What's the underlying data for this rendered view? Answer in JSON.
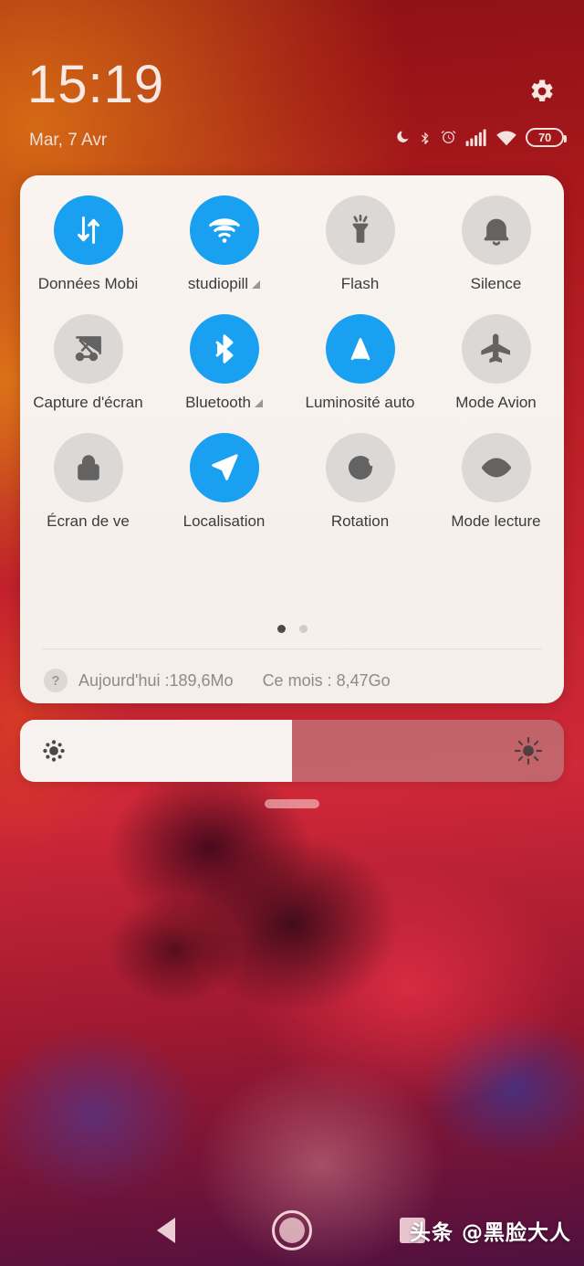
{
  "header": {
    "clock": "15:19",
    "date": "Mar, 7 Avr",
    "settings_icon": "gear-icon",
    "status_icons": [
      {
        "name": "do-not-disturb-moon-icon"
      },
      {
        "name": "bluetooth-icon"
      },
      {
        "name": "alarm-clock-icon"
      },
      {
        "name": "cellular-signal-icon"
      },
      {
        "name": "wifi-icon"
      }
    ],
    "battery_level": "70"
  },
  "quick_settings": {
    "tiles": [
      {
        "label": "Données Mobi",
        "icon": "mobile-data-arrows-icon",
        "active": true,
        "has_arrow": false
      },
      {
        "label": "studiopill",
        "icon": "wifi-icon",
        "active": true,
        "has_arrow": true
      },
      {
        "label": "Flash",
        "icon": "flashlight-icon",
        "active": false,
        "has_arrow": false
      },
      {
        "label": "Silence",
        "icon": "bell-icon",
        "active": false,
        "has_arrow": false
      },
      {
        "label": "Capture d'écran",
        "icon": "screenshot-scissors-icon",
        "active": false,
        "has_arrow": false
      },
      {
        "label": "Bluetooth",
        "icon": "bluetooth-icon",
        "active": true,
        "has_arrow": true
      },
      {
        "label": "Luminosité auto",
        "icon": "auto-brightness-a-icon",
        "active": true,
        "has_arrow": false
      },
      {
        "label": "Mode Avion",
        "icon": "airplane-icon",
        "active": false,
        "has_arrow": false
      },
      {
        "label": "Écran de ve",
        "icon": "lock-icon",
        "active": false,
        "has_arrow": false
      },
      {
        "label": "Localisation",
        "icon": "location-arrow-icon",
        "active": true,
        "has_arrow": false
      },
      {
        "label": "Rotation",
        "icon": "rotation-lock-icon",
        "active": false,
        "has_arrow": false
      },
      {
        "label": "Mode lecture",
        "icon": "eye-icon",
        "active": false,
        "has_arrow": false
      }
    ],
    "pages": {
      "count": 2,
      "active_index": 0
    },
    "data_usage": {
      "help_icon": "question-mark-icon",
      "today": "Aujourd'hui :189,6Mo",
      "month": "Ce mois : 8,47Go"
    }
  },
  "brightness": {
    "value_percent": 50,
    "low_icon": "brightness-low-sun-icon",
    "high_icon": "brightness-high-sun-icon"
  },
  "navbar": {
    "back": "back-triangle-icon",
    "home": "home-circle-icon",
    "recents": "recents-square-icon",
    "watermark": "头条 @黑脸大人"
  },
  "colors": {
    "accent_on": "#1aa0f0",
    "tile_off": "#dcd8d5",
    "panel_bg": "#f7f1ed"
  }
}
